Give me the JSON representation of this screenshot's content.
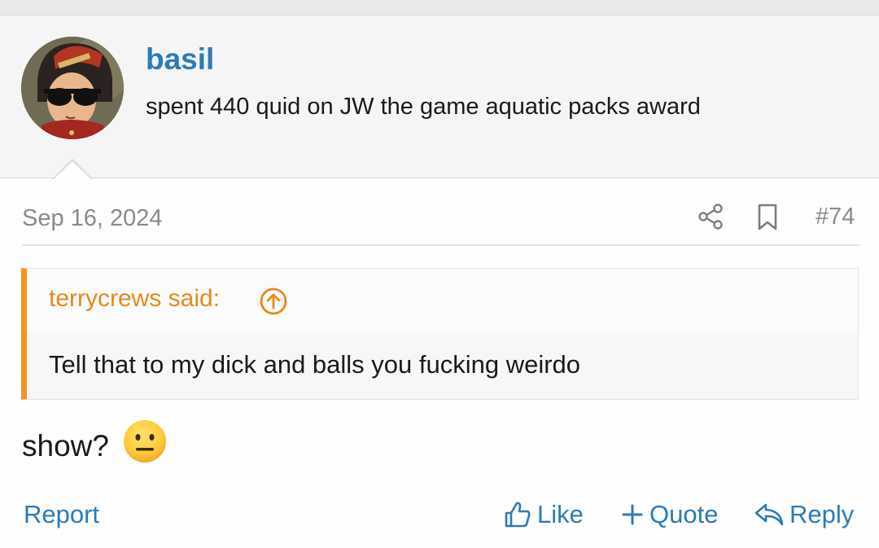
{
  "post": {
    "username": "basil",
    "user_title": "spent 440 quid on JW the game aquatic packs award",
    "date": "Sep 16, 2024",
    "number": "#74",
    "body_text": "show?",
    "body_emoji": "neutral-face-icon"
  },
  "quote": {
    "author_label": "terrycrews said:",
    "text": "Tell that to my dick and balls you fucking weirdo"
  },
  "actions": {
    "report": "Report",
    "like": "Like",
    "quote": "Quote",
    "reply": "Reply"
  },
  "icons": [
    "share-icon",
    "bookmark-icon",
    "arrow-up-circle-icon",
    "thumbs-up-icon",
    "plus-icon",
    "reply-arrow-icon"
  ],
  "colors": {
    "link": "#2b7bb9",
    "quote_accent": "#f7941e",
    "muted": "#8a8a8a"
  }
}
